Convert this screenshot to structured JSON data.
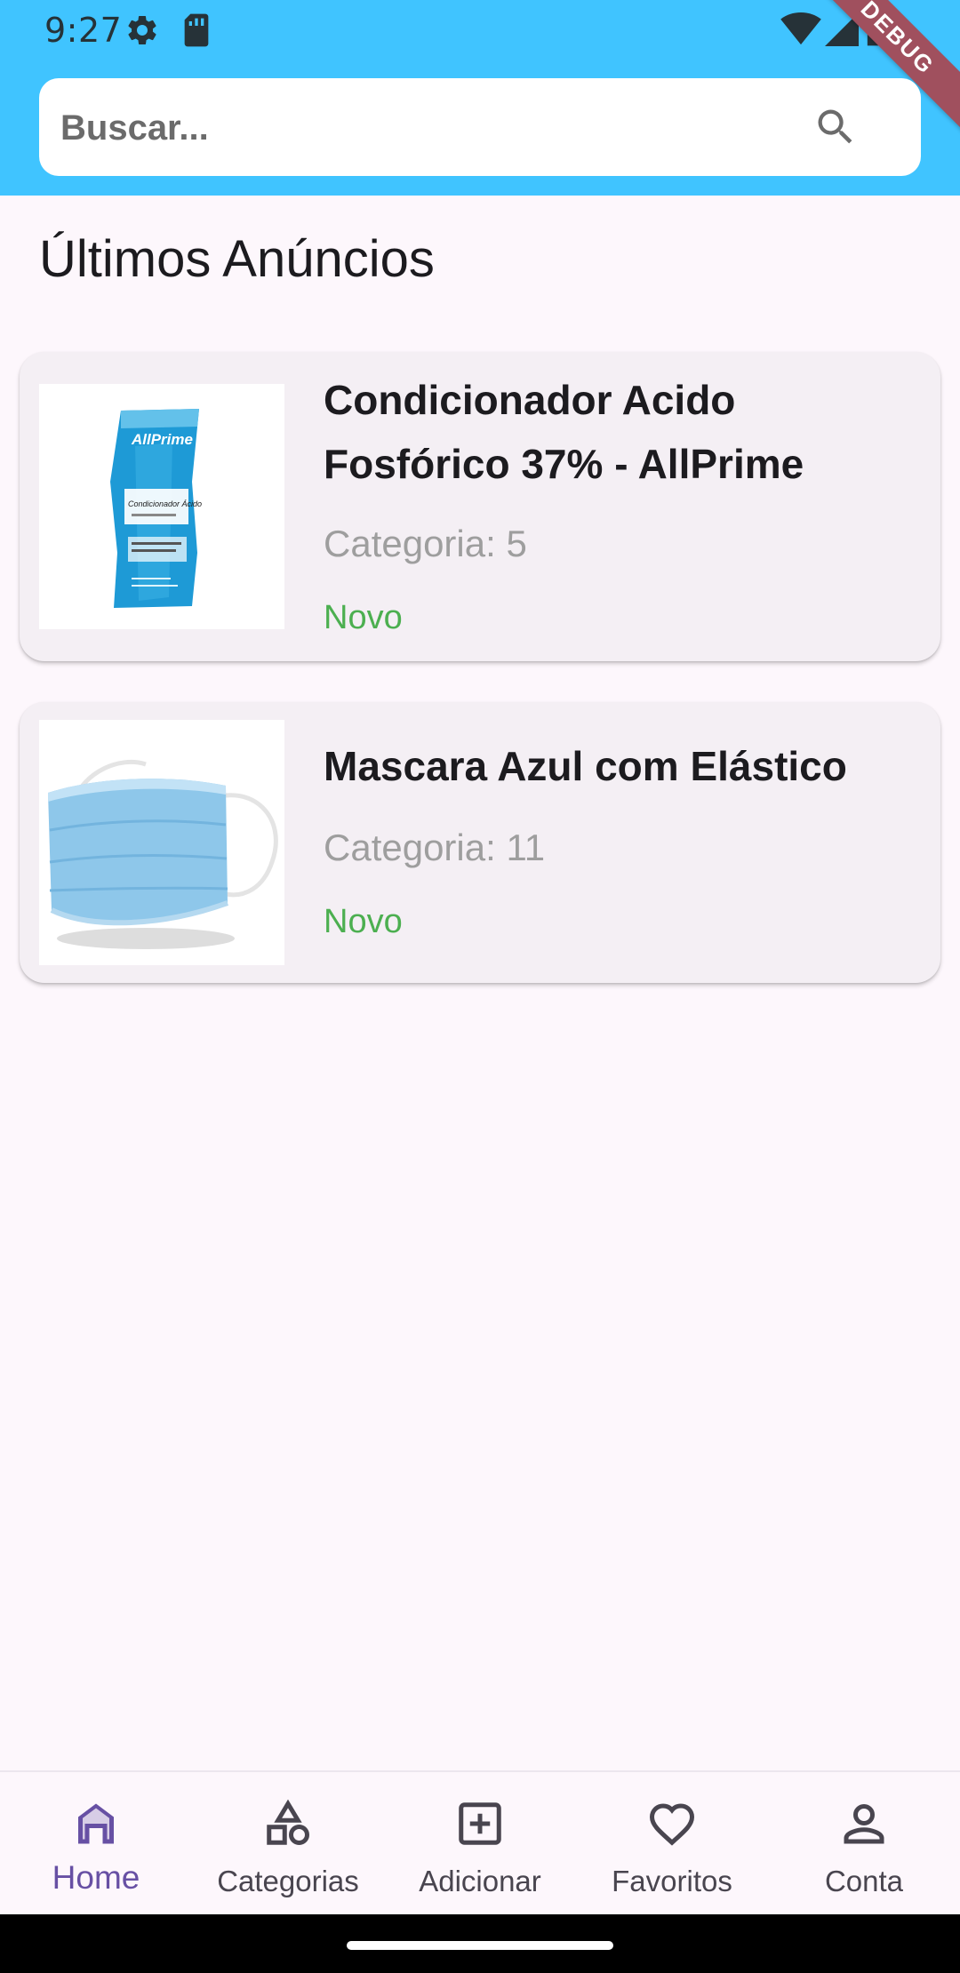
{
  "status_bar": {
    "time": "9:27",
    "icons": [
      "settings-icon",
      "sd-card-icon",
      "wifi-icon",
      "cell-signal-icon",
      "battery-icon"
    ]
  },
  "debug_banner": "DEBUG",
  "search": {
    "placeholder": "Buscar...",
    "value": ""
  },
  "section": {
    "title": "Últimos Anúncios"
  },
  "listings": [
    {
      "title": "Condicionador Acido Fosfórico 37% - AllPrime",
      "category": "Categoria: 5",
      "condition": "Novo",
      "image_brand": "AllPrime",
      "image_product": "Condicionador Ácido"
    },
    {
      "title": "Mascara Azul com Elástico",
      "category": "Categoria: 11",
      "condition": "Novo"
    }
  ],
  "bottom_nav": {
    "items": [
      {
        "label": "Home",
        "icon": "home-icon",
        "active": true
      },
      {
        "label": "Categorias",
        "icon": "categories-icon",
        "active": false
      },
      {
        "label": "Adicionar",
        "icon": "add-box-icon",
        "active": false
      },
      {
        "label": "Favoritos",
        "icon": "heart-icon",
        "active": false
      },
      {
        "label": "Conta",
        "icon": "person-icon",
        "active": false
      }
    ]
  },
  "colors": {
    "header": "#40c4ff",
    "background": "#fdf7fc",
    "card": "#f4eff4",
    "condition": "#4caf50",
    "nav_active": "#6750a4",
    "nav_inactive": "#49454f",
    "debug_ribbon": "#a0505e"
  }
}
